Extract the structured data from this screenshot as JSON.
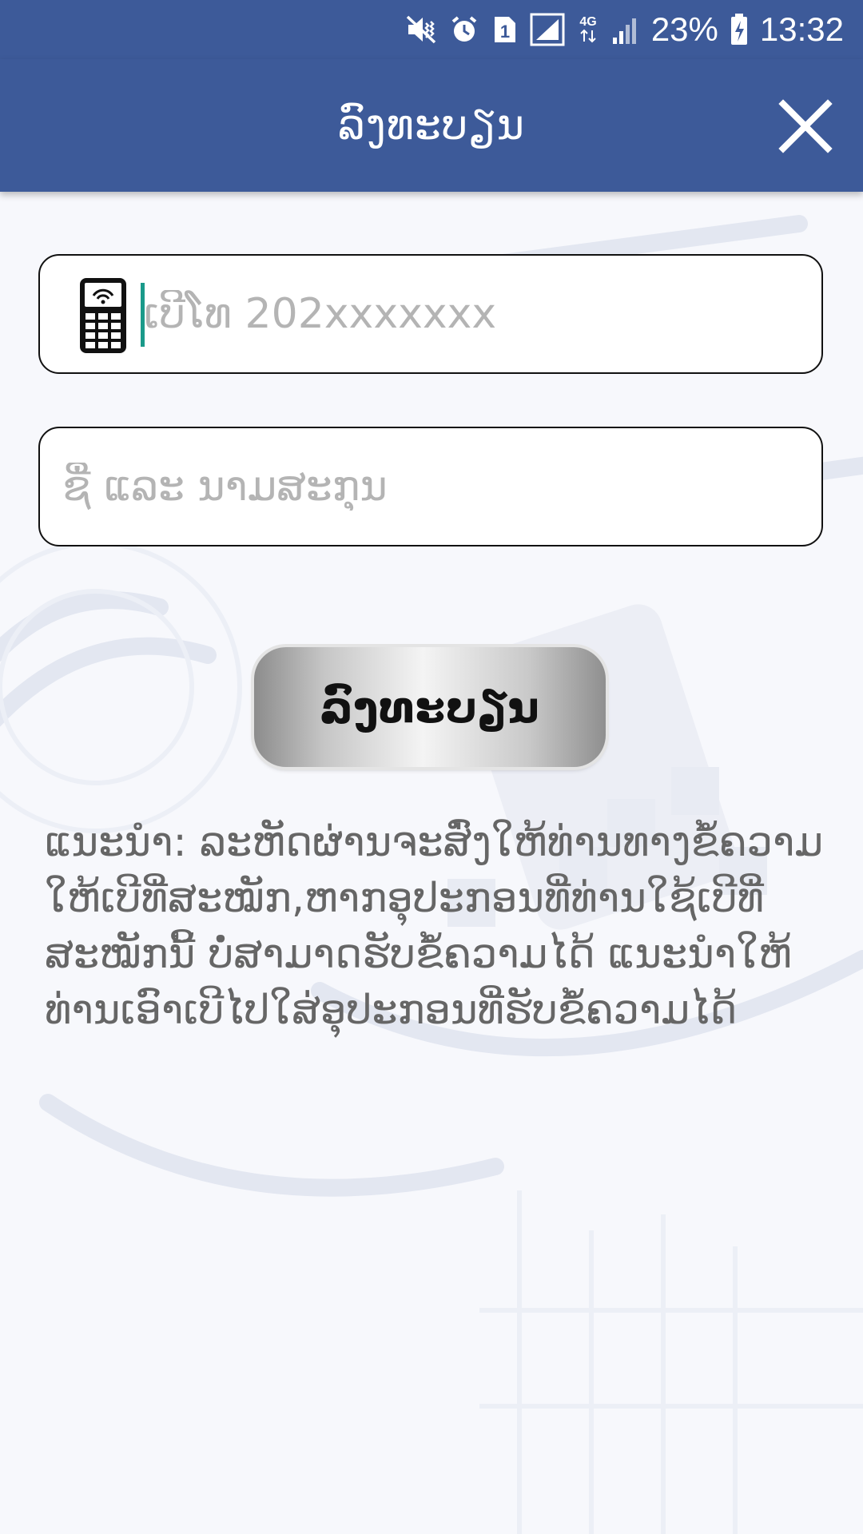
{
  "status_bar": {
    "battery": "23%",
    "time": "13:32",
    "sim_number": "1",
    "network": "4G",
    "icons": [
      "mute-vibrate-icon",
      "alarm-icon",
      "sim-icon",
      "signal-icon",
      "4g-icon",
      "signal-icon",
      "battery-charging-icon"
    ]
  },
  "appbar": {
    "title": "ລົງທະບຽນ",
    "close_icon": "close-icon"
  },
  "form": {
    "phone": {
      "icon": "mobile-phone-icon",
      "placeholder": "ເບີໂທ 202xxxxxxx",
      "value": ""
    },
    "name": {
      "placeholder": "ຊື່ ແລະ ນາມສະກຸນ",
      "value": ""
    },
    "submit_label": "ລົງທະບຽນ"
  },
  "instruction": "ແນະນຳ: ລະຫັດຜ່ານຈະສົ່ງໃຫ້ທ່ານທາງຂໍ້ຄວາມໃຫ້ເບີທີ່ສະໝັກ,ຫາກອຸປະກອນທີ່ທ່ານໃຊ້ເບີທີ່ສະໝັກນີ້ ບໍ່ສາມາດຮັບຂໍ້ຄວາມໄດ້ ແນະນຳໃຫ້ທ່ານເອົາເບີໄປໃສ່ອຸປະກອນທີ່ຮັບຂໍ້ຄວາມໄດ້",
  "colors": {
    "primary": "#3d5a99",
    "caret": "#1a9a8a",
    "placeholder": "#b4b4b4",
    "instruction_text": "#666666"
  }
}
